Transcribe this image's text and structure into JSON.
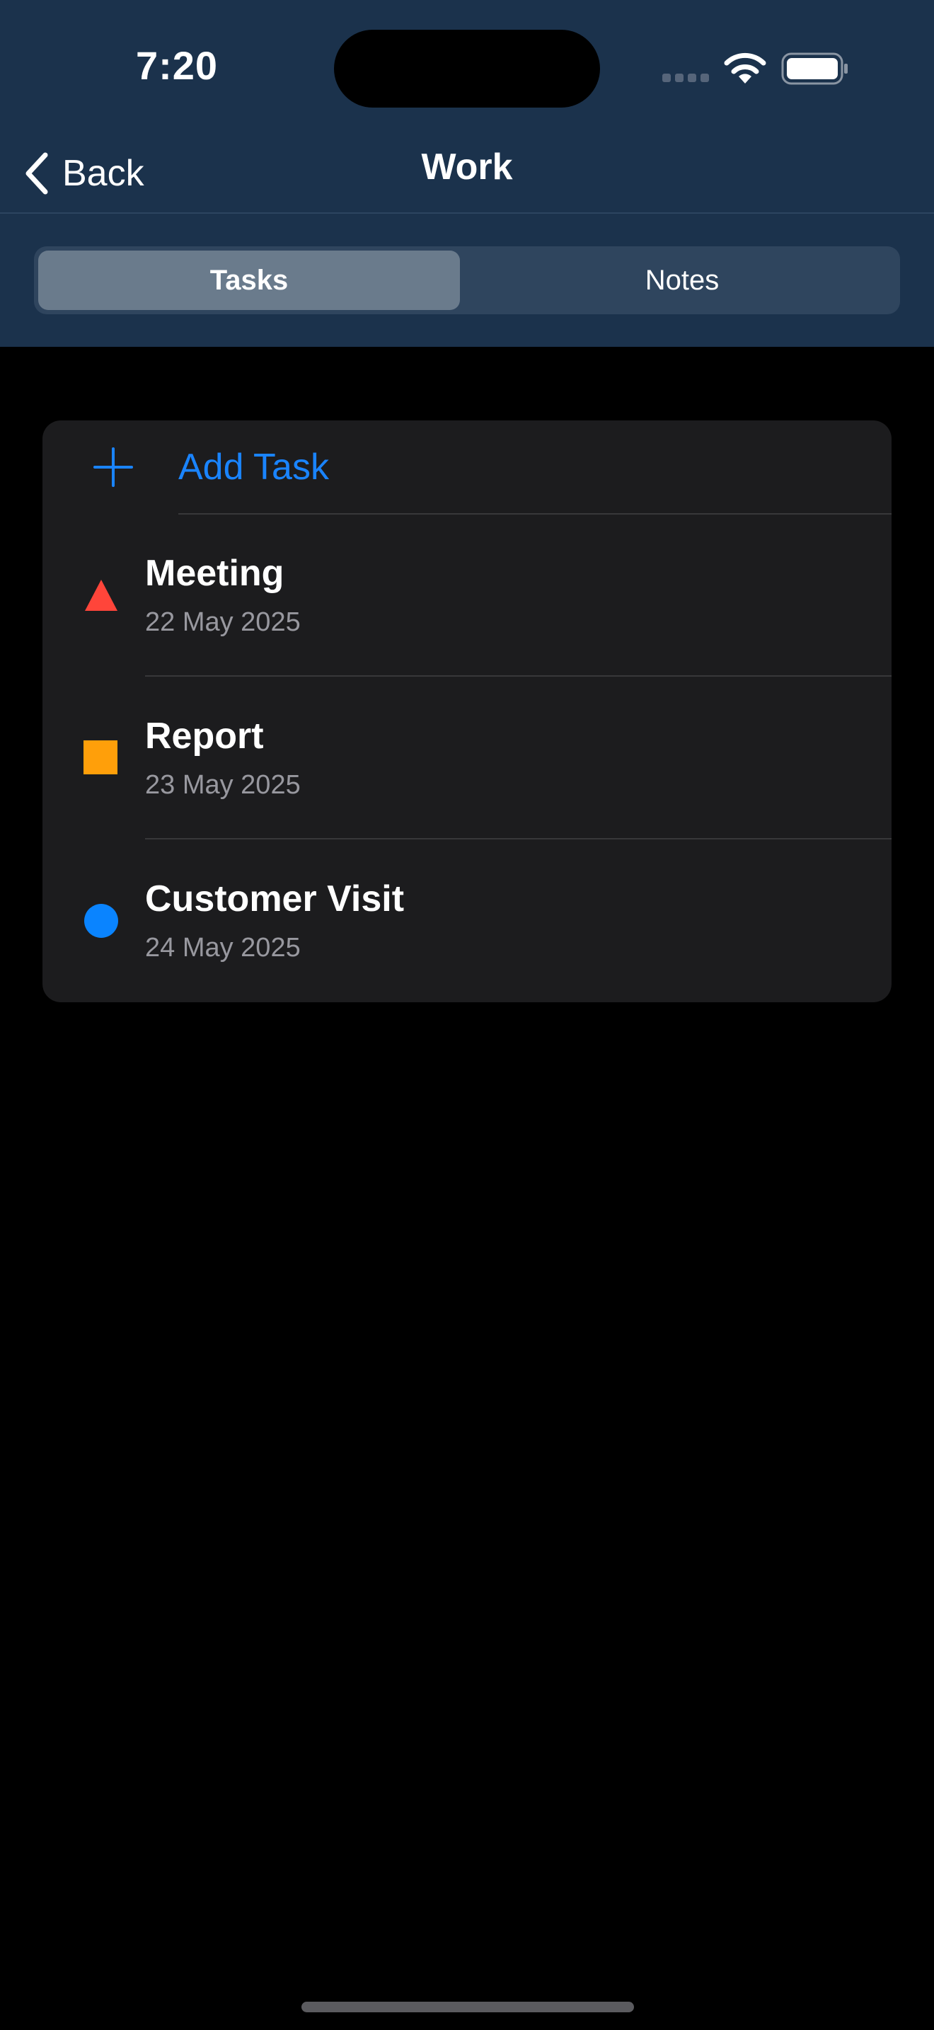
{
  "status_bar": {
    "time": "7:20"
  },
  "nav": {
    "back_label": "Back",
    "title": "Work"
  },
  "segments": {
    "tasks_label": "Tasks",
    "notes_label": "Notes",
    "selected": "Tasks"
  },
  "task_list": {
    "add_label": "Add Task",
    "items": [
      {
        "title": "Meeting",
        "date": "22 May 2025",
        "shape": "triangle-icon",
        "color": "#ff453a"
      },
      {
        "title": "Report",
        "date": "23 May 2025",
        "shape": "square-icon",
        "color": "#ff9f0a"
      },
      {
        "title": "Customer Visit",
        "date": "24 May 2025",
        "shape": "circle-icon",
        "color": "#0a84ff"
      }
    ]
  },
  "colors": {
    "header_background": "#1b324c",
    "accent": "#1a84ff",
    "card_background": "#1c1c1e"
  }
}
